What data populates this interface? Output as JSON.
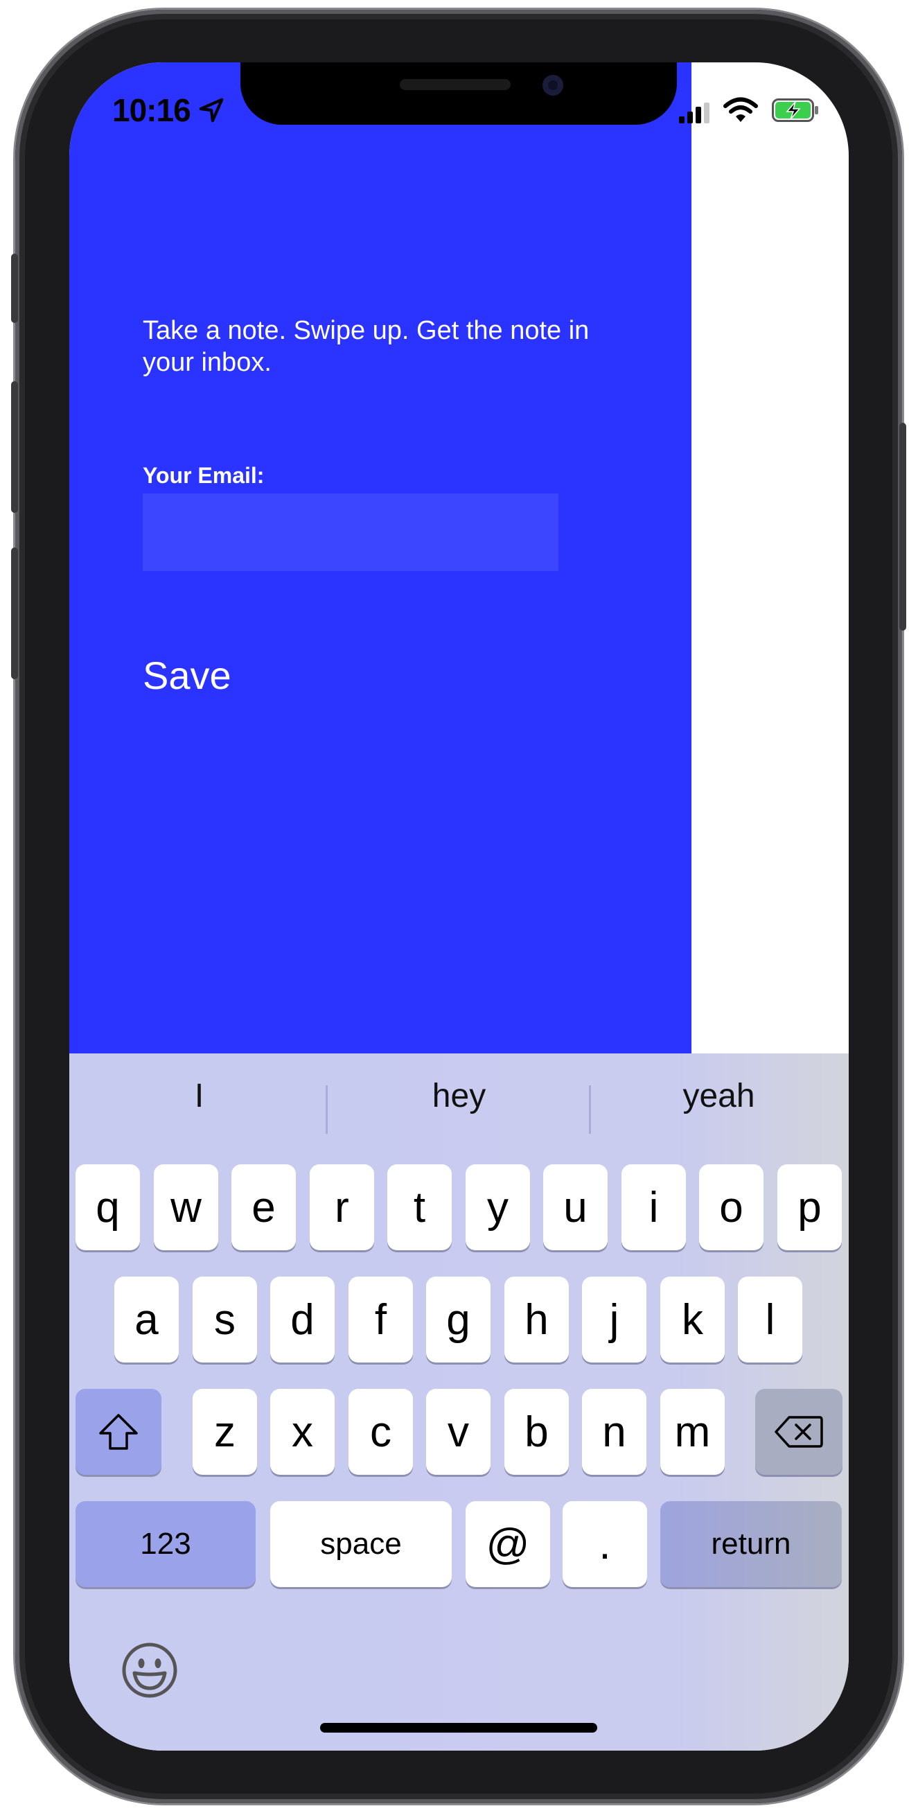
{
  "status_bar": {
    "time": "10:16",
    "icons": [
      "location-arrow-icon",
      "cellular-signal-icon",
      "wifi-icon",
      "battery-charging-icon"
    ]
  },
  "app": {
    "tagline": "Take a note. Swipe up. Get the note in your inbox.",
    "email_label": "Your Email:",
    "email_value": "",
    "save_label": "Save",
    "colors": {
      "panel": "#2a33ff",
      "input": "#3d46ff",
      "text": "#ffffff"
    }
  },
  "keyboard": {
    "suggestions": [
      "I",
      "hey",
      "yeah"
    ],
    "row1": [
      "q",
      "w",
      "e",
      "r",
      "t",
      "y",
      "u",
      "i",
      "o",
      "p"
    ],
    "row2": [
      "a",
      "s",
      "d",
      "f",
      "g",
      "h",
      "j",
      "k",
      "l"
    ],
    "row3": [
      "z",
      "x",
      "c",
      "v",
      "b",
      "n",
      "m"
    ],
    "numbers_label": "123",
    "space_label": "space",
    "at_label": "@",
    "dot_label": ".",
    "return_label": "return",
    "icons": [
      "shift-icon",
      "backspace-icon",
      "emoji-icon"
    ]
  }
}
